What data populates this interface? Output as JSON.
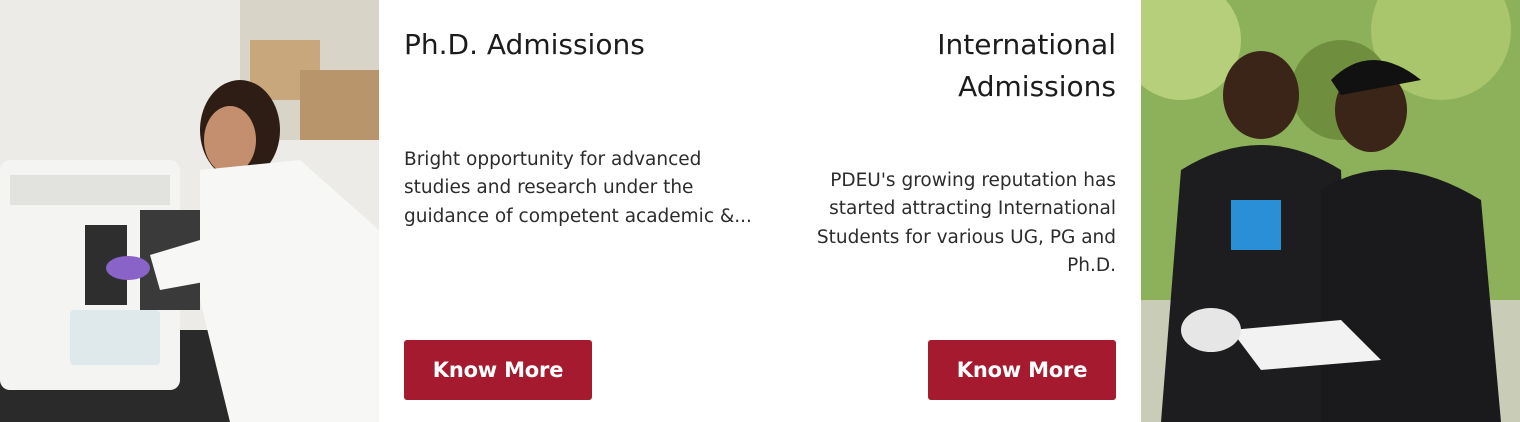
{
  "colors": {
    "accent": "#a51a2e",
    "heading": "#1c1c1c",
    "body_text": "#2c2c2c"
  },
  "images": {
    "left": "photo-researcher-lab",
    "right": "photo-students-reading"
  },
  "cards": [
    {
      "title": "Ph.D. Admissions",
      "description": "Bright opportunity for advanced studies and research under the guidance of competent academic &...",
      "button_label": "Know More"
    },
    {
      "title": "International Admissions",
      "description": "PDEU's growing reputation has started attracting International Students for various UG, PG and Ph.D.",
      "button_label": "Know More"
    }
  ]
}
